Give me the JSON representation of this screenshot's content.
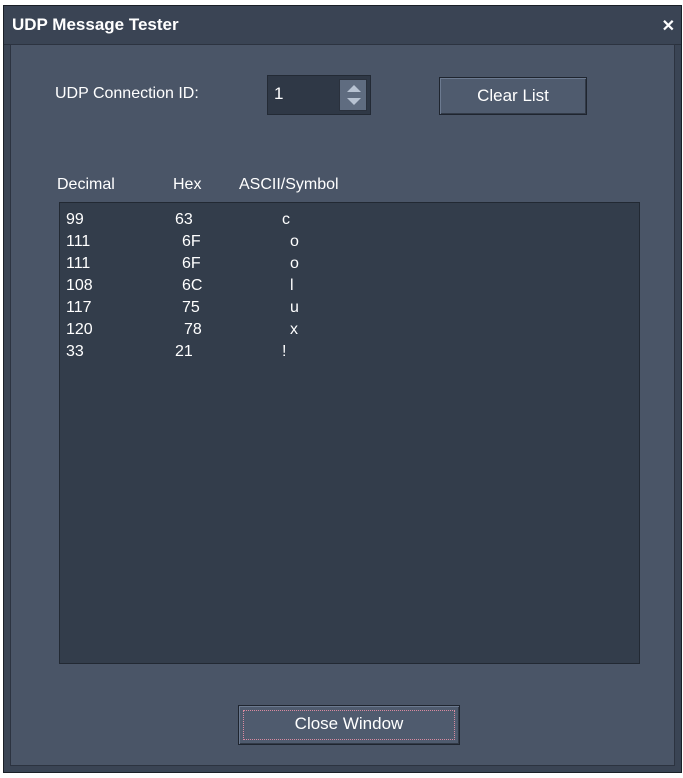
{
  "window": {
    "title": "UDP Message Tester",
    "close_glyph": "✕"
  },
  "connection": {
    "label": "UDP Connection ID:",
    "value": "1"
  },
  "buttons": {
    "clear_list": "Clear List",
    "close_window": "Close Window"
  },
  "columns": {
    "decimal": "Decimal",
    "hex": "Hex",
    "ascii": "ASCII/Symbol"
  },
  "rows": [
    {
      "decimal": "99",
      "hex": "63",
      "ascii": "c"
    },
    {
      "decimal": "111",
      "hex": "6F",
      "ascii": "o"
    },
    {
      "decimal": "111",
      "hex": "6F",
      "ascii": "o"
    },
    {
      "decimal": "108",
      "hex": "6C",
      "ascii": "l"
    },
    {
      "decimal": "117",
      "hex": "75",
      "ascii": "u"
    },
    {
      "decimal": "120",
      "hex": "78",
      "ascii": "x"
    },
    {
      "decimal": "33",
      "hex": "21",
      "ascii": "!"
    }
  ],
  "colors": {
    "window_bg": "#3a4454",
    "panel_bg": "#4a5567",
    "list_bg": "#333d4b",
    "text": "#ffffff"
  }
}
